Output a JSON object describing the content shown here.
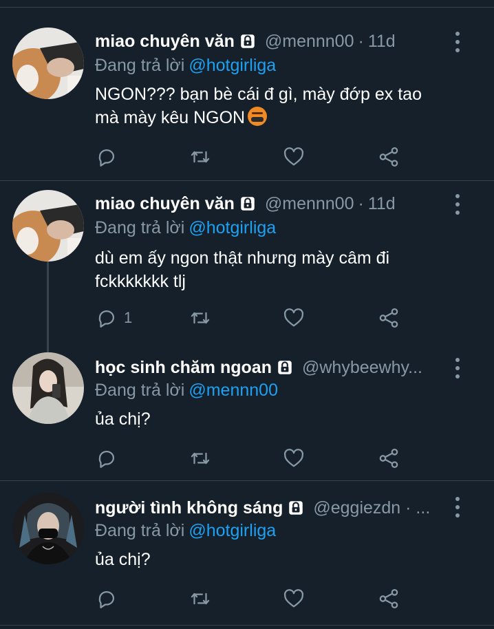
{
  "tweets": [
    {
      "name": "miao chuyên văn",
      "handle": "@mennn00",
      "dot": "·",
      "time": "11d",
      "reply_prefix": "Đang trả lời",
      "reply_to": "@hotgirliga",
      "text_line1": "NGON??? bạn bè cái đ gì, mày đớp ex tao",
      "text_line2": "mà mày kêu NGON",
      "emoji": "face-with-symbols-on-mouth",
      "reply_count": ""
    },
    {
      "name": "miao chuyên văn",
      "handle": "@mennn00",
      "dot": "·",
      "time": "11d",
      "reply_prefix": "Đang trả lời",
      "reply_to": "@hotgirliga",
      "text_line1": "dù em ấy ngon thật nhưng mày câm đi",
      "text_line2": "fckkkkkkk tlj",
      "reply_count": "1"
    },
    {
      "name": "học sinh chăm ngoan",
      "handle": "@whybeewhy...",
      "reply_prefix": "Đang trả lời",
      "reply_to": "@mennn00",
      "text_line1": "ủa chị?",
      "reply_count": ""
    },
    {
      "name": "người tình không sáng",
      "handle": "@eggiezdn · ...",
      "reply_prefix": "Đang trả lời",
      "reply_to": "@hotgirliga",
      "text_line1": "ủa chị?",
      "reply_count": ""
    }
  ],
  "icons": {
    "lock": "lock-icon",
    "more": "more-vertical-icon",
    "reply": "reply-icon",
    "retweet": "retweet-icon",
    "like": "heart-icon",
    "share": "share-icon"
  },
  "colors": {
    "background": "#15202b",
    "secondary_text": "#8899a6",
    "mention": "#1da1f2",
    "divider": "#38444d"
  }
}
